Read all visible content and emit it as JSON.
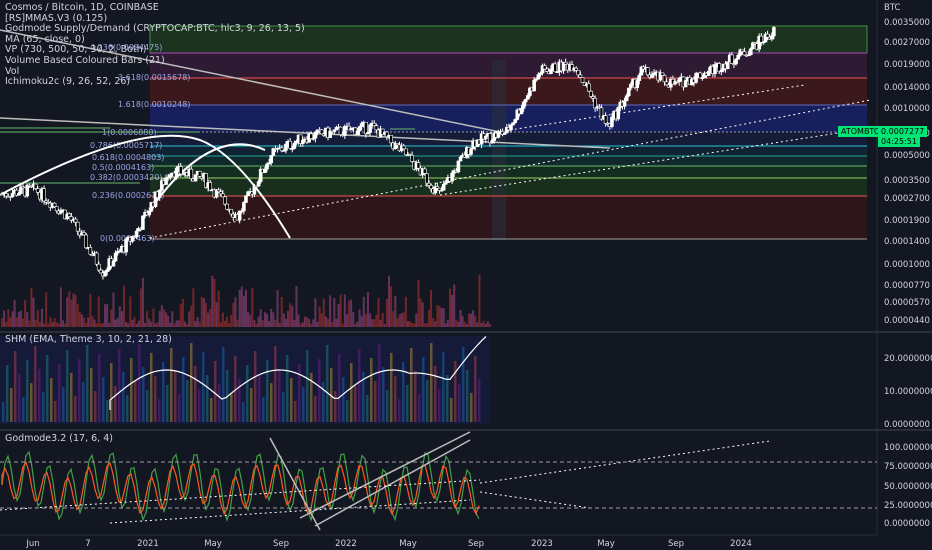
{
  "legend": {
    "symbol": "Cosmos / Bitcoin, 1D, COINBASE",
    "lines": [
      "[RS]MMAS.V3 (0.125)",
      "Godmode Supply/Demand (CRYPTOCAP:BTC, hlc3, 9, 26, 13, 5)",
      "MA (65, close, 0)",
      "VP (730, 500, 50, 30, 2, Both)",
      "Volume Based Coloured Bars (21)",
      "Vol",
      "Ichimoku2c (9, 26, 52, 26)"
    ]
  },
  "price_axis": {
    "currency": "BTC",
    "ticks": [
      "0.0035000",
      "0.0027000",
      "0.0019000",
      "0.0014000",
      "0.0010000",
      "0.0007000",
      "0.0005000",
      "0.0003500",
      "0.0002700",
      "0.0001900",
      "0.0001400",
      "0.0001000",
      "0.0000770",
      "0.0000570",
      "0.0000440"
    ]
  },
  "last_price_badge": {
    "symbol": "ATOMBTC",
    "price": "0.0007277",
    "countdown": "04:25:51",
    "color": "#00e676"
  },
  "fib_labels": [
    "4.236(0.0024475)",
    "3.618(0.0015678)",
    "1.618(0.0010248)",
    "1(0.0006880)",
    "0.786(0.0005717)",
    "0.618(0.0004803)",
    "0.5(0.0004163)",
    "0.382(0.0003420)",
    "0.236(0.0002615)",
    "0(0.0001463)"
  ],
  "shm_pane": {
    "title": "SHM (EMA, Theme 3, 10, 2, 21, 28)",
    "ticks": [
      "20.0000000",
      "10.0000000",
      "0.0000000"
    ]
  },
  "godmode_pane": {
    "title": "Godmode3.2 (17, 6, 4)",
    "ticks": [
      "100.0000000",
      "75.0000000",
      "50.0000000",
      "25.0000000",
      "0.0000000"
    ]
  },
  "time_axis": [
    "Jun",
    "7",
    "2021",
    "May",
    "Sep",
    "2022",
    "May",
    "Sep",
    "2023",
    "May",
    "Sep",
    "2024"
  ],
  "colors": {
    "background": "#131722",
    "candle": "#ffffff",
    "fib_blue": "#1a237e",
    "fib_red": "#4a1414",
    "fib_green": "#1b3a1b",
    "supply_zone": "#2e7d32",
    "grid": "#1e222d"
  },
  "chart_data": {
    "type": "candlestick",
    "title": "Cosmos / Bitcoin, 1D, COINBASE",
    "y_scale": "log",
    "ylim": [
      4.4e-05,
      0.0035
    ],
    "x": [
      "2020-06",
      "2020-07",
      "2020-09",
      "2020-11",
      "2021-01",
      "2021-03",
      "2021-05",
      "2021-07",
      "2021-09",
      "2021-11",
      "2022-01",
      "2022-03",
      "2022-05",
      "2022-07",
      "2022-09",
      "2022-11",
      "2023-01",
      "2023-03",
      "2023-05",
      "2023-07",
      "2023-09",
      "2023-11",
      "2024-01",
      "2024-03"
    ],
    "close": [
      0.00028,
      0.0003,
      0.0002,
      9e-05,
      0.00016,
      0.0004,
      0.00035,
      0.0002,
      0.0005,
      0.00065,
      0.0007,
      0.00075,
      0.0005,
      0.00028,
      0.0006,
      0.0007,
      0.0017,
      0.0019,
      0.00075,
      0.0017,
      0.0014,
      0.0017,
      0.0022,
      0.0031
    ],
    "last": 0.0007277
  }
}
